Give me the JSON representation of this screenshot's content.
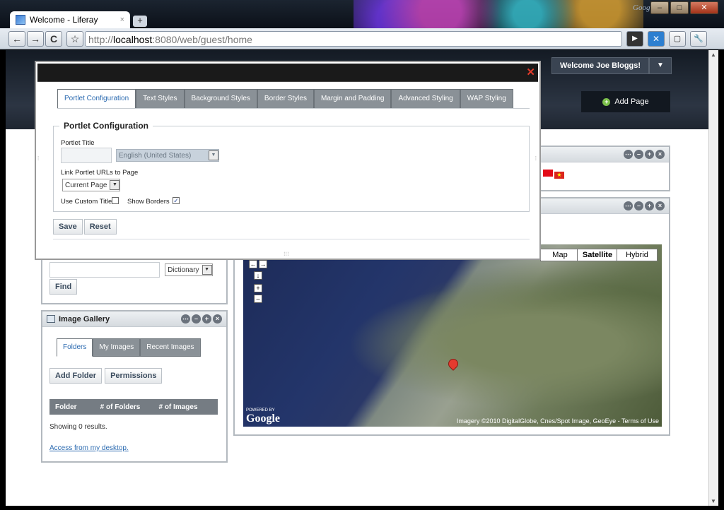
{
  "browser": {
    "tab_title": "Welcome - Liferay",
    "tab_close": "×",
    "new_tab": "+",
    "google_mark": "Google",
    "url_scheme": "http://",
    "url_host": "localhost",
    "url_path": ":8080/web/guest/home",
    "win_min": "–",
    "win_max": "□",
    "win_close": "✕",
    "back": "←",
    "forward": "→",
    "reload": "C",
    "star": "☆",
    "go": "▶",
    "page_menu": "▢",
    "tools_menu": "🔧"
  },
  "header": {
    "welcome": "Welcome Joe Bloggs!",
    "welcome_arrow": "▼",
    "add_page": "Add Page",
    "add_plus": "+"
  },
  "dialog": {
    "close": "✕",
    "tabs": [
      "Portlet Configuration",
      "Text Styles",
      "Background Styles",
      "Border Styles",
      "Margin and Padding",
      "Advanced Styling",
      "WAP Styling"
    ],
    "legend": "Portlet Configuration",
    "portlet_title_label": "Portlet Title",
    "language_select": "English (United States)",
    "link_urls_label": "Link Portlet URLs to Page",
    "link_select": "Current Page",
    "use_custom_title": "Use Custom Title",
    "show_borders": "Show Borders",
    "show_borders_checked": "✓",
    "save": "Save",
    "reset": "Reset",
    "grip": "⁝⁝⁝"
  },
  "dictionary": {
    "select": "Dictionary",
    "find": "Find"
  },
  "image_gallery": {
    "title": "Image Gallery",
    "tabs": [
      "Folders",
      "My Images",
      "Recent Images"
    ],
    "add_folder": "Add Folder",
    "permissions": "Permissions",
    "columns": [
      "Folder",
      "# of Folders",
      "# of Images"
    ],
    "showing": "Showing 0 results.",
    "access_link": "Access from my desktop."
  },
  "portlet_icons": [
    "⋯",
    "–",
    "+",
    "×"
  ],
  "map": {
    "types": [
      "Map",
      "Satellite",
      "Hybrid"
    ],
    "pan_left": "←",
    "pan_right": "→",
    "pan_down": "↓",
    "zoom_in": "+",
    "zoom_out": "–",
    "powered": "POWERED BY",
    "google": "Google",
    "credits": "Imagery ©2010 DigitalGlobe, Cnes/Spot Image, GeoEye - Terms of Use"
  },
  "colors": {
    "accent_link": "#2b6ab0",
    "dialog_titlebar": "#1a1a1a",
    "tab_inactive": "#8a9197"
  }
}
